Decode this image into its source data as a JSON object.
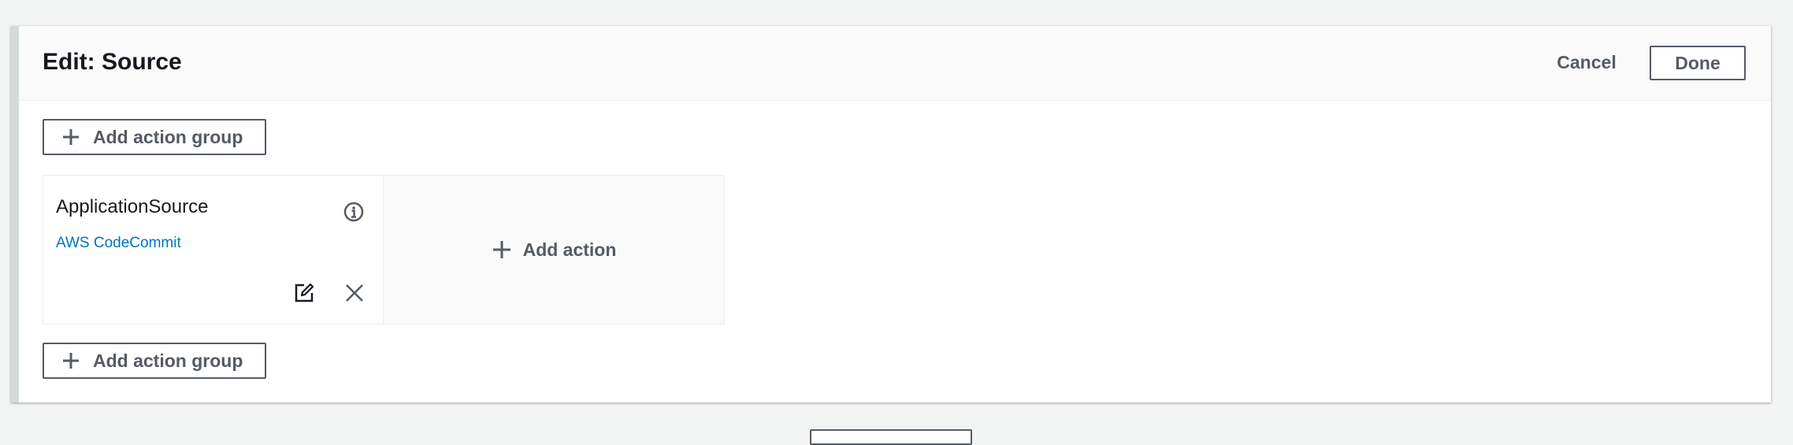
{
  "stage": {
    "title": "Edit: Source",
    "cancel_label": "Cancel",
    "done_label": "Done"
  },
  "add_action_group_top": {
    "label": "Add action group",
    "icon": "plus-icon"
  },
  "action_group": {
    "action": {
      "name": "ApplicationSource",
      "provider": "AWS CodeCommit",
      "icons": [
        "info-icon",
        "edit-icon",
        "remove-icon"
      ]
    },
    "add_action": {
      "label": "Add action",
      "icon": "plus-icon"
    }
  },
  "add_action_group_bottom": {
    "label": "Add action group",
    "icon": "plus-icon"
  },
  "colors": {
    "page_background": "#f2f3f3",
    "panel_background": "#ffffff",
    "text_primary": "#16191f",
    "text_secondary": "#545b64",
    "link": "#0073bb"
  }
}
